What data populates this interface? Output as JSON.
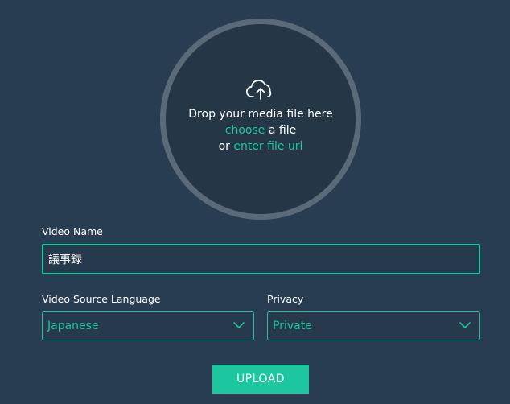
{
  "dropzone": {
    "icon": "cloud-upload-icon",
    "line1": "Drop your media file here",
    "choose_link": "choose",
    "line2_suffix": " a file",
    "line3_prefix": "or ",
    "url_link": "enter file url"
  },
  "form": {
    "video_name": {
      "label": "Video Name",
      "value": "議事録"
    },
    "language": {
      "label": "Video Source Language",
      "selected": "Japanese"
    },
    "privacy": {
      "label": "Privacy",
      "selected": "Private"
    },
    "upload_label": "UPLOAD"
  },
  "colors": {
    "background": "#293d52",
    "accent": "#1cc69f",
    "ring": "#5a6a79"
  }
}
